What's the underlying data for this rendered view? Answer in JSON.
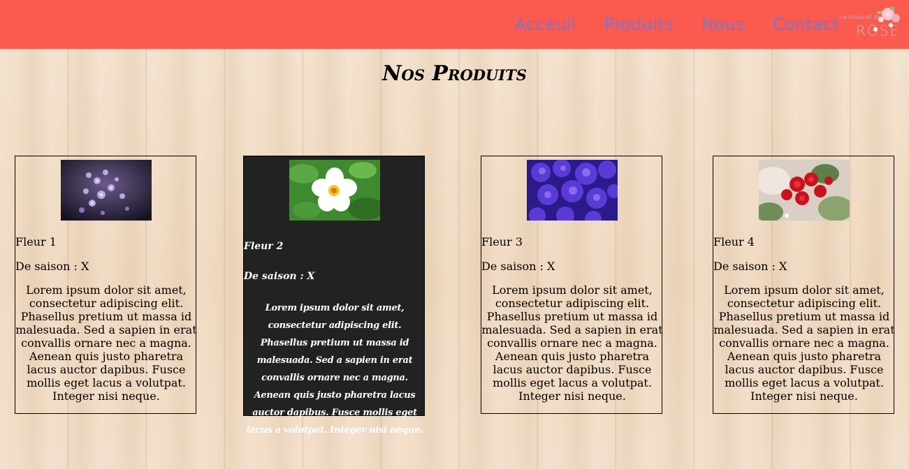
{
  "nav": {
    "links": [
      "Acceuil",
      "Produits",
      "Nous",
      "Contact"
    ],
    "logo_small": "Le bouquet de",
    "logo_big": "ROSE"
  },
  "page": {
    "title": "Nos Produits"
  },
  "products": [
    {
      "name": "Fleur 1",
      "season": "De saison : X",
      "description": "Lorem ipsum dolor sit amet, consectetur adipiscing elit. Phasellus pretium ut massa id malesuada. Sed a sapien in erat convallis ornare nec a magna. Aenean quis justo pharetra lacus auctor dapibus. Fusce mollis eget lacus a volutpat. Integer nisi neque.",
      "image": "purple-wildflowers-photo"
    },
    {
      "name": "Fleur 2",
      "season": "De saison : X",
      "description": "Lorem ipsum dolor sit amet, consectetur adipiscing elit. Phasellus pretium ut massa id malesuada. Sed a sapien in erat convallis ornare nec a magna. Aenean quis justo pharetra lacus auctor dapibus. Fusce mollis eget lacus a volutpat. Integer nisi neque.",
      "image": "white-flower-photo"
    },
    {
      "name": "Fleur 3",
      "season": "De saison : X",
      "description": "Lorem ipsum dolor sit amet, consectetur adipiscing elit. Phasellus pretium ut massa id malesuada. Sed a sapien in erat convallis ornare nec a magna. Aenean quis justo pharetra lacus auctor dapibus. Fusce mollis eget lacus a volutpat. Integer nisi neque.",
      "image": "blue-hydrangea-photo"
    },
    {
      "name": "Fleur 4",
      "season": "De saison : X",
      "description": "Lorem ipsum dolor sit amet, consectetur adipiscing elit. Phasellus pretium ut massa id malesuada. Sed a sapien in erat convallis ornare nec a magna. Aenean quis justo pharetra lacus auctor dapibus. Fusce mollis eget lacus a volutpat. Integer nisi neque.",
      "image": "red-roses-photo"
    }
  ],
  "colors": {
    "navbar": "#fb5a4f",
    "nav_link": "#7d74c7",
    "card_dark": "#222222"
  }
}
